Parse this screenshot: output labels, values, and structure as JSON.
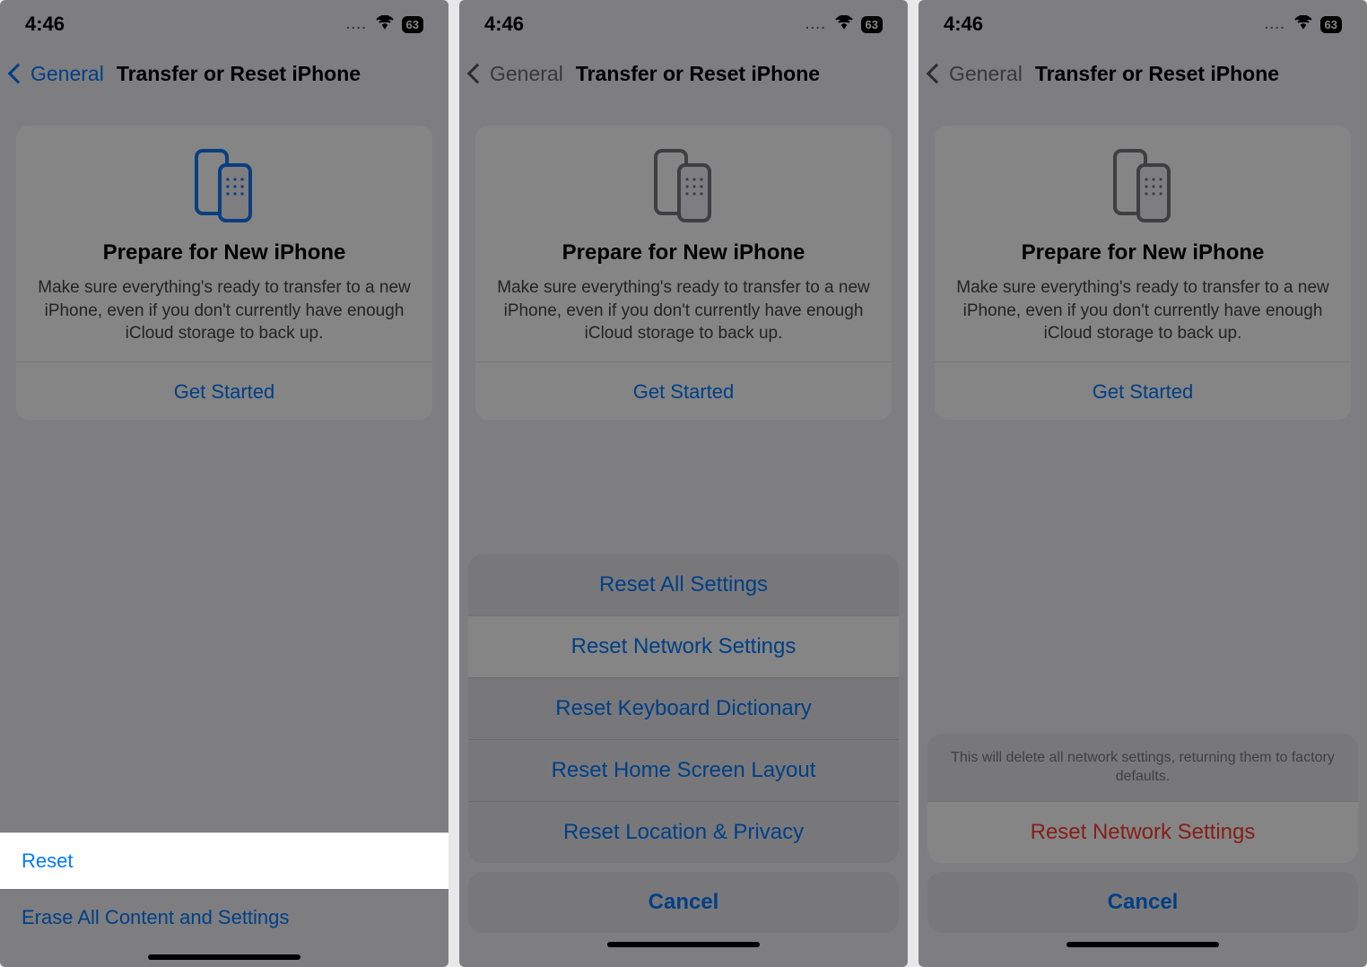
{
  "status": {
    "time": "4:46",
    "battery": "63"
  },
  "nav": {
    "back": "General",
    "title": "Transfer or Reset iPhone"
  },
  "card": {
    "heading": "Prepare for New iPhone",
    "body": "Make sure everything's ready to transfer to a new iPhone, even if you don't currently have enough iCloud storage to back up.",
    "cta": "Get Started"
  },
  "list": {
    "reset": "Reset",
    "erase": "Erase All Content and Settings"
  },
  "sheet": {
    "items": [
      "Reset All Settings",
      "Reset Network Settings",
      "Reset Keyboard Dictionary",
      "Reset Home Screen Layout",
      "Reset Location & Privacy"
    ],
    "cancel": "Cancel"
  },
  "confirm": {
    "note": "This will delete all network settings, returning them to factory defaults.",
    "action": "Reset Network Settings",
    "cancel": "Cancel"
  }
}
